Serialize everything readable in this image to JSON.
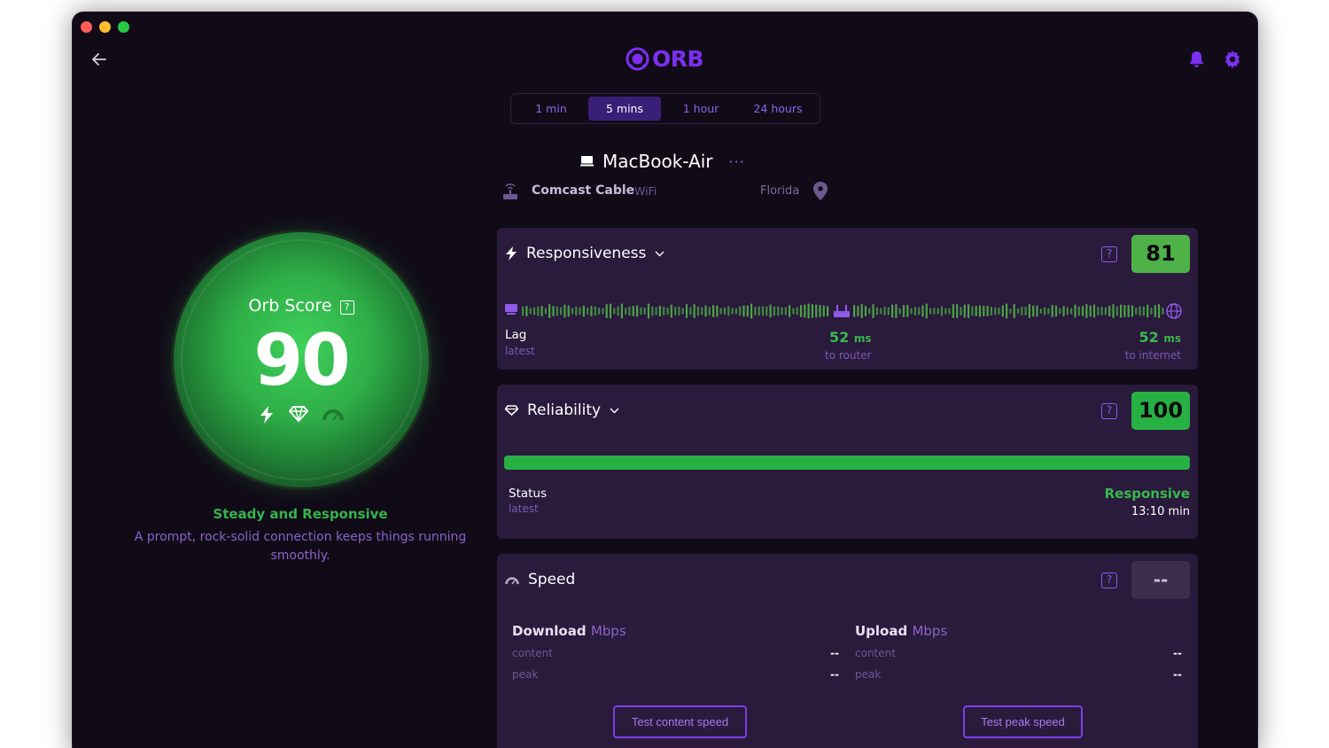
{
  "app": {
    "logo": "ORB"
  },
  "time_ranges": [
    "1 min",
    "5 mins",
    "1 hour",
    "24 hours"
  ],
  "active_range": "5 mins",
  "device": {
    "name": "MacBook-Air",
    "more": "···"
  },
  "network": {
    "isp": "Comcast Cable",
    "type": "WiFi",
    "location": "Florida"
  },
  "orb": {
    "title": "Orb Score",
    "help": "?",
    "score": "90",
    "summary_title": "Steady and Responsive",
    "summary_text": "A prompt, rock-solid connection keeps things running smoothly."
  },
  "responsiveness": {
    "title": "Responsiveness",
    "help": "?",
    "score": "81",
    "lag_label": "Lag",
    "lag_sub": "latest",
    "router_value": "52",
    "router_unit": "ms",
    "router_sub": "to router",
    "internet_value": "52",
    "internet_unit": "ms",
    "internet_sub": "to internet",
    "badge_color": "#4fb248"
  },
  "reliability": {
    "title": "Reliability",
    "help": "?",
    "score": "100",
    "bar_fill": 1.0,
    "status_label": "Status",
    "status_sub": "latest",
    "status_value": "Responsive",
    "status_time": "13:10 min",
    "badge_color": "#27b144"
  },
  "speed": {
    "title": "Speed",
    "help": "?",
    "score": "--",
    "download": {
      "label": "Download",
      "unit": "Mbps",
      "content_label": "content",
      "content_value": "--",
      "peak_label": "peak",
      "peak_value": "--"
    },
    "upload": {
      "label": "Upload",
      "unit": "Mbps",
      "content_label": "content",
      "content_value": "--",
      "peak_label": "peak",
      "peak_value": "--"
    },
    "test_content_button": "Test content speed",
    "test_peak_button": "Test peak speed",
    "badge_color": "#3d2e4c"
  },
  "colors": {
    "accent": "#7b2ff0",
    "green": "#35b34c",
    "background": "#110b18",
    "card": "#2a1a3c"
  },
  "icons": [
    "back-arrow-icon",
    "orb-logo-icon",
    "bell-icon",
    "gear-icon",
    "laptop-icon",
    "router-icon",
    "location-pin-icon",
    "bolt-icon",
    "diamond-icon",
    "gauge-icon",
    "globe-icon",
    "chevron-down-icon",
    "help-icon"
  ]
}
